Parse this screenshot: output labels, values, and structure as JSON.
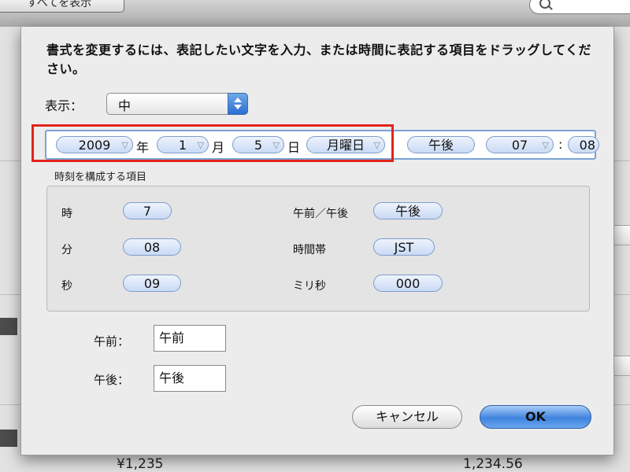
{
  "background": {
    "show_all_label": "すべてを表示",
    "bottom_values": {
      "yen": "¥1,235",
      "number": "1,234.56"
    }
  },
  "dialog": {
    "instructions": "書式を変更するには、表記したい文字を入力、または時間に表記する項目をドラッグしてください。",
    "show_label": "表示：",
    "show_value": "中",
    "format_tokens": {
      "year": "2009",
      "year_sep": "年",
      "month": "1",
      "month_sep": "月",
      "day": "5",
      "day_sep": "日",
      "weekday": "月曜日",
      "ampm": "午後",
      "hour": "07",
      "colon": ":",
      "minute": "08"
    },
    "components_title": "時刻を構成する項目",
    "components": {
      "hour_label": "時",
      "hour_value": "7",
      "minute_label": "分",
      "minute_value": "08",
      "second_label": "秒",
      "second_value": "09",
      "ampm_label": "午前／午後",
      "ampm_value": "午後",
      "timezone_label": "時間帯",
      "timezone_value": "JST",
      "ms_label": "ミリ秒",
      "ms_value": "000"
    },
    "am_label": "午前：",
    "am_value": "午前",
    "pm_label": "午後：",
    "pm_value": "午後",
    "cancel_label": "キャンセル",
    "ok_label": "OK"
  },
  "colors": {
    "highlight": "#e3241c",
    "accent": "#3f84e0"
  },
  "icons": {
    "search": "search-icon",
    "popup_arrows": "popup-arrows-icon",
    "token_chevron": "chevron-down-icon"
  }
}
